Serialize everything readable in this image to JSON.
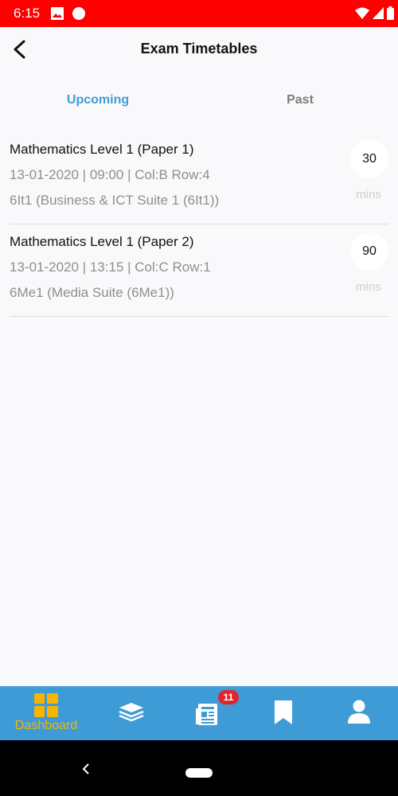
{
  "status_bar": {
    "time": "6:15",
    "icons": [
      "image-icon",
      "circle-icon",
      "wifi-icon",
      "signal-icon",
      "battery-icon"
    ],
    "color": "#fe0000"
  },
  "app_bar": {
    "title": "Exam Timetables",
    "back_icon": "back-arrow-icon"
  },
  "tabs": [
    {
      "label": "Upcoming",
      "active": true
    },
    {
      "label": "Past",
      "active": false
    }
  ],
  "exams": [
    {
      "title": "Mathematics Level 1 (Paper 1)",
      "meta": "13-01-2020 | 09:00 |  Col:B Row:4",
      "room": "6It1 (Business & ICT Suite 1 (6It1))",
      "duration": "30",
      "unit": "mins"
    },
    {
      "title": "Mathematics Level 1 (Paper 2)",
      "meta": "13-01-2020 | 13:15 |  Col:C Row:1",
      "room": "6Me1 (Media Suite (6Me1))",
      "duration": "90",
      "unit": "mins"
    }
  ],
  "bottom_nav": {
    "items": [
      {
        "icon": "dashboard-icon",
        "label": "Dashboard",
        "active": true
      },
      {
        "icon": "layers-icon"
      },
      {
        "icon": "newspaper-icon",
        "badge": "11"
      },
      {
        "icon": "bookmark-icon"
      },
      {
        "icon": "person-icon"
      }
    ],
    "background": "#3e9bd5",
    "active_color": "#f7b500",
    "badge_color": "#e0262b"
  },
  "system_nav": {
    "back_icon": "system-back-icon",
    "home_icon": "home-pill-icon"
  }
}
